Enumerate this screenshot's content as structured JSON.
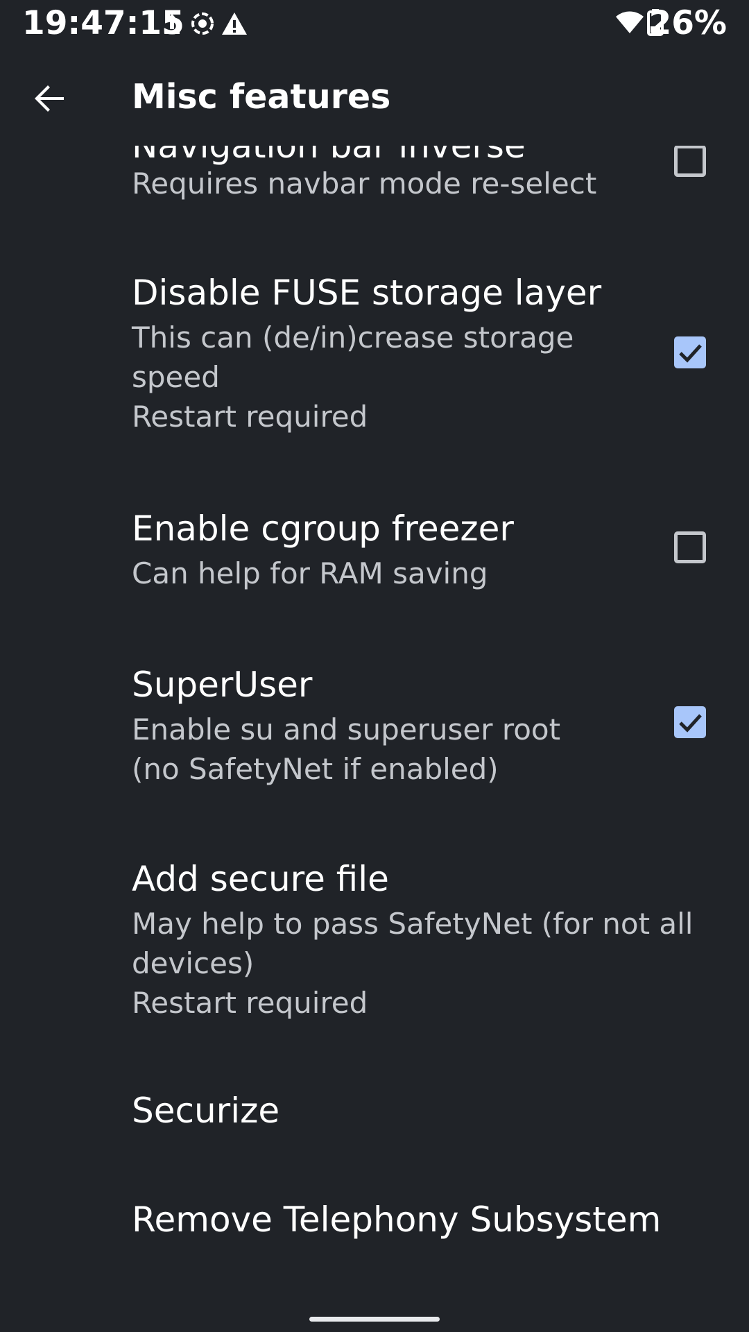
{
  "status_bar": {
    "time": "19:47:15",
    "icons": [
      "upload-icon",
      "screen-record-icon",
      "alert-icon"
    ],
    "right_icons": [
      "wifi-icon",
      "battery-icon"
    ],
    "battery_percent": "26%"
  },
  "toolbar": {
    "title": "Misc features",
    "back_icon": "arrow-back-icon"
  },
  "prefs": [
    {
      "title": "Navigation bar inverse",
      "summary": "Requires navbar mode re-select",
      "checked": false
    },
    {
      "title": "Disable FUSE storage layer",
      "summary": "This can (de/in)crease storage speed\nRestart required",
      "checked": true
    },
    {
      "title": "Enable cgroup freezer",
      "summary": "Can help for RAM saving",
      "checked": false
    },
    {
      "title": "SuperUser",
      "summary": "Enable su and superuser root (no SafetyNet if enabled)",
      "checked": true
    },
    {
      "title": "Add secure file",
      "summary": "May help to pass SafetyNet (for not all devices)\nRestart required"
    },
    {
      "title": "Securize"
    },
    {
      "title": "Remove Telephony Subsystem"
    }
  ],
  "colors": {
    "background": "#202328",
    "accent": "#a8c6fa",
    "summary_text": "#c4c7cc"
  }
}
